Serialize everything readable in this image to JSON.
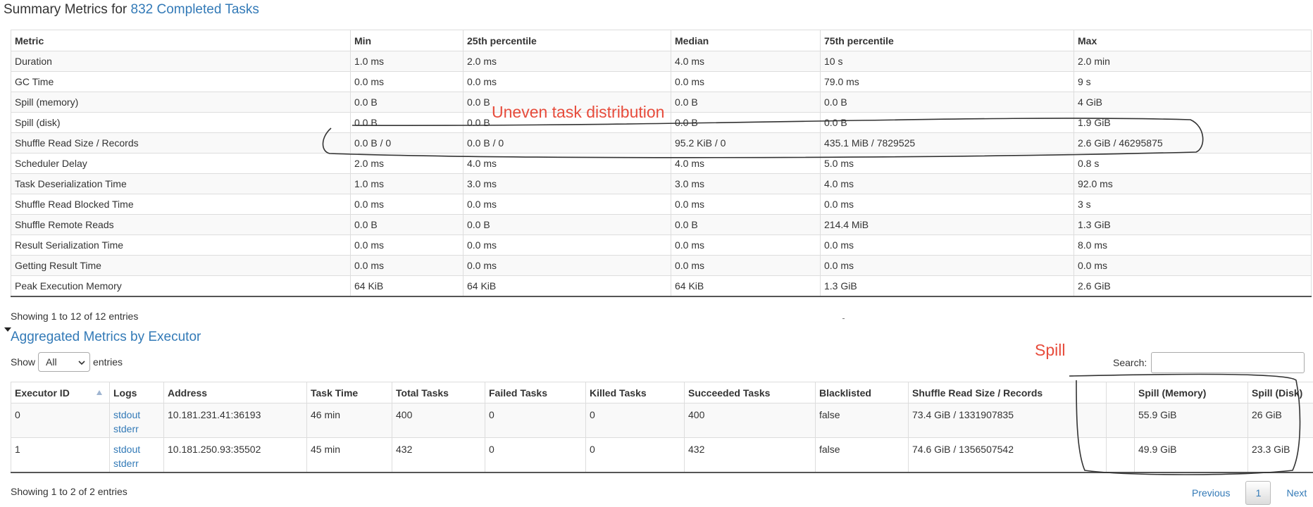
{
  "summary": {
    "title_prefix": "Summary Metrics for ",
    "title_link": "832 Completed Tasks",
    "columns": [
      "Metric",
      "Min",
      "25th percentile",
      "Median",
      "75th percentile",
      "Max"
    ],
    "rows": [
      [
        "Duration",
        "1.0 ms",
        "2.0 ms",
        "4.0 ms",
        "10 s",
        "2.0 min"
      ],
      [
        "GC Time",
        "0.0 ms",
        "0.0 ms",
        "0.0 ms",
        "79.0 ms",
        "9 s"
      ],
      [
        "Spill (memory)",
        "0.0 B",
        "0.0 B",
        "0.0 B",
        "0.0 B",
        "4 GiB"
      ],
      [
        "Spill (disk)",
        "0.0 B",
        "0.0 B",
        "0.0 B",
        "0.0 B",
        "1.9 GiB"
      ],
      [
        "Shuffle Read Size / Records",
        "0.0 B / 0",
        "0.0 B / 0",
        "95.2 KiB / 0",
        "435.1 MiB / 7829525",
        "2.6 GiB / 46295875"
      ],
      [
        "Scheduler Delay",
        "2.0 ms",
        "4.0 ms",
        "4.0 ms",
        "5.0 ms",
        "0.8 s"
      ],
      [
        "Task Deserialization Time",
        "1.0 ms",
        "3.0 ms",
        "3.0 ms",
        "4.0 ms",
        "92.0 ms"
      ],
      [
        "Shuffle Read Blocked Time",
        "0.0 ms",
        "0.0 ms",
        "0.0 ms",
        "0.0 ms",
        "3 s"
      ],
      [
        "Shuffle Remote Reads",
        "0.0 B",
        "0.0 B",
        "0.0 B",
        "214.4 MiB",
        "1.3 GiB"
      ],
      [
        "Result Serialization Time",
        "0.0 ms",
        "0.0 ms",
        "0.0 ms",
        "0.0 ms",
        "8.0 ms"
      ],
      [
        "Getting Result Time",
        "0.0 ms",
        "0.0 ms",
        "0.0 ms",
        "0.0 ms",
        "0.0 ms"
      ],
      [
        "Peak Execution Memory",
        "64 KiB",
        "64 KiB",
        "64 KiB",
        "1.3 GiB",
        "2.6 GiB"
      ]
    ],
    "info": "Showing 1 to 12 of 12 entries"
  },
  "executors": {
    "title": "Aggregated Metrics by Executor",
    "show_label": "Show",
    "show_value": "All",
    "entries_label": "entries",
    "search_label": "Search:",
    "search_value": "",
    "columns": [
      "Executor ID",
      "Logs",
      "Address",
      "Task Time",
      "Total Tasks",
      "Failed Tasks",
      "Killed Tasks",
      "Succeeded Tasks",
      "Blacklisted",
      "Shuffle Read Size / Records",
      "",
      "Spill (Memory)",
      "Spill (Disk)"
    ],
    "rows": [
      {
        "id": "0",
        "logs": [
          "stdout",
          "stderr"
        ],
        "address": "10.181.231.41:36193",
        "task_time": "46 min",
        "total": "400",
        "failed": "0",
        "killed": "0",
        "succeeded": "400",
        "blacklisted": "false",
        "shuffle": "73.4 GiB / 1331907835",
        "extra": "",
        "spill_mem": "55.9 GiB",
        "spill_disk": "26 GiB"
      },
      {
        "id": "1",
        "logs": [
          "stdout",
          "stderr"
        ],
        "address": "10.181.250.93:35502",
        "task_time": "45 min",
        "total": "432",
        "failed": "0",
        "killed": "0",
        "succeeded": "432",
        "blacklisted": "false",
        "shuffle": "74.6 GiB / 1356507542",
        "extra": "",
        "spill_mem": "49.9 GiB",
        "spill_disk": "23.3 GiB"
      }
    ],
    "info": "Showing 1 to 2 of 2 entries",
    "pager": {
      "previous": "Previous",
      "current": "1",
      "next": "Next"
    }
  },
  "annotations": {
    "uneven": "Uneven task distribution",
    "spill": "Spill",
    "color": "#e74c3c"
  }
}
